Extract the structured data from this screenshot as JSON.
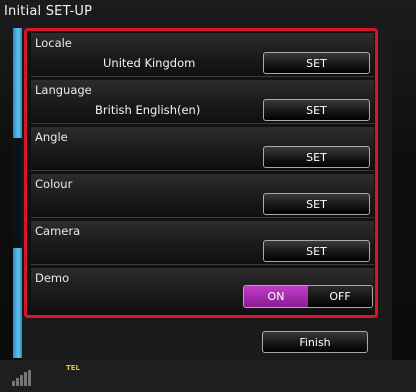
{
  "screen": {
    "title": "Initial SET-UP"
  },
  "settings": [
    {
      "label": "Locale",
      "value": "United Kingdom",
      "button": "SET"
    },
    {
      "label": "Language",
      "value": "British English(en)",
      "button": "SET"
    },
    {
      "label": "Angle",
      "value": "",
      "button": "SET"
    },
    {
      "label": "Colour",
      "value": "",
      "button": "SET"
    },
    {
      "label": "Camera",
      "value": "",
      "button": "SET"
    }
  ],
  "demo": {
    "label": "Demo",
    "on": "ON",
    "off": "OFF",
    "selected": "ON"
  },
  "actions": {
    "finish": "Finish"
  },
  "status": {
    "tel": "TEL"
  },
  "colors": {
    "highlight_border": "#d8162a",
    "accent_strip": "#5ec6ee",
    "toggle_on": "#b02fb8"
  }
}
